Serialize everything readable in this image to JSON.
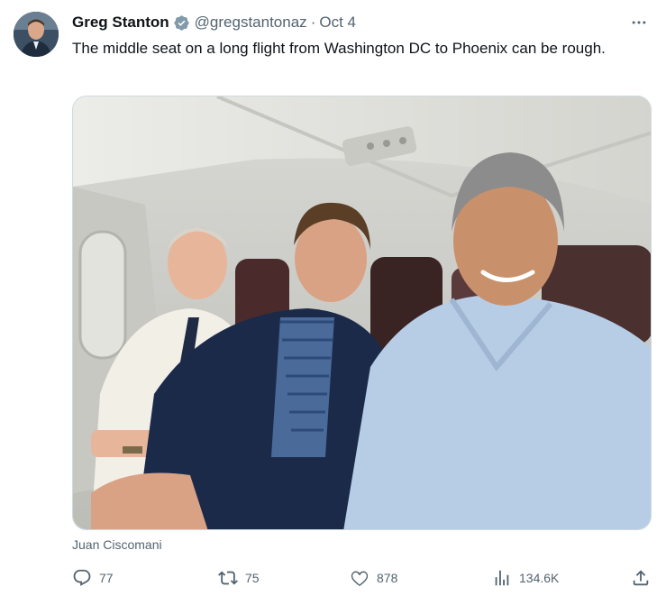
{
  "author": {
    "display_name": "Greg Stanton",
    "handle": "@gregstantonaz",
    "separator": "·",
    "date": "Oct 4",
    "verified_icon": "verified-badge-icon"
  },
  "tweet": {
    "text": "The middle seat on a long flight from Washington DC to Phoenix can be rough."
  },
  "media": {
    "tagged_user": "Juan Ciscomani"
  },
  "actions": {
    "replies": "77",
    "retweets": "75",
    "likes": "878",
    "views": "134.6K"
  },
  "colors": {
    "text_primary": "#0f1419",
    "text_secondary": "#536471",
    "verified_blue": "#1d9bf0"
  }
}
